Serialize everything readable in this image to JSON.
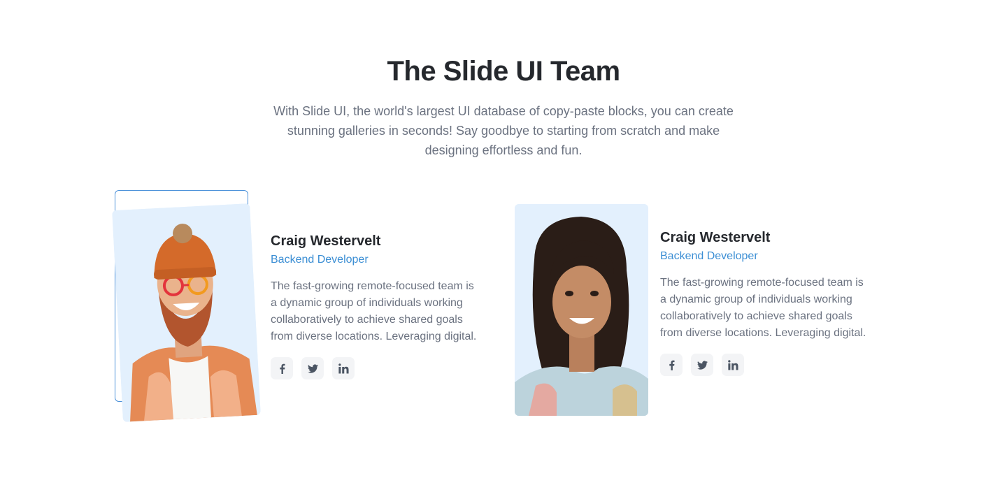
{
  "section": {
    "title": "The Slide UI Team",
    "description": "With Slide UI, the world's largest UI database of copy-paste blocks, you can create stunning galleries in seconds! Say goodbye to starting from scratch and make designing effortless and fun."
  },
  "members": [
    {
      "name": "Craig Westervelt",
      "role": "Backend Developer",
      "bio": "The fast-growing remote-focused team is a dynamic group of individuals working collaboratively to achieve shared goals from diverse locations. Leveraging digital.",
      "socials": [
        "facebook-icon",
        "twitter-icon",
        "linkedin-icon"
      ]
    },
    {
      "name": "Craig Westervelt",
      "role": "Backend Developer",
      "bio": "The fast-growing remote-focused team is a dynamic group of individuals working collaboratively to achieve shared goals from diverse locations. Leveraging digital.",
      "socials": [
        "facebook-icon",
        "twitter-icon",
        "linkedin-icon"
      ]
    }
  ],
  "colors": {
    "accent": "#3b8ed4",
    "photo_bg": "#e3f0fd",
    "frame_border": "#4a90d9",
    "text_muted": "#6b7280"
  }
}
